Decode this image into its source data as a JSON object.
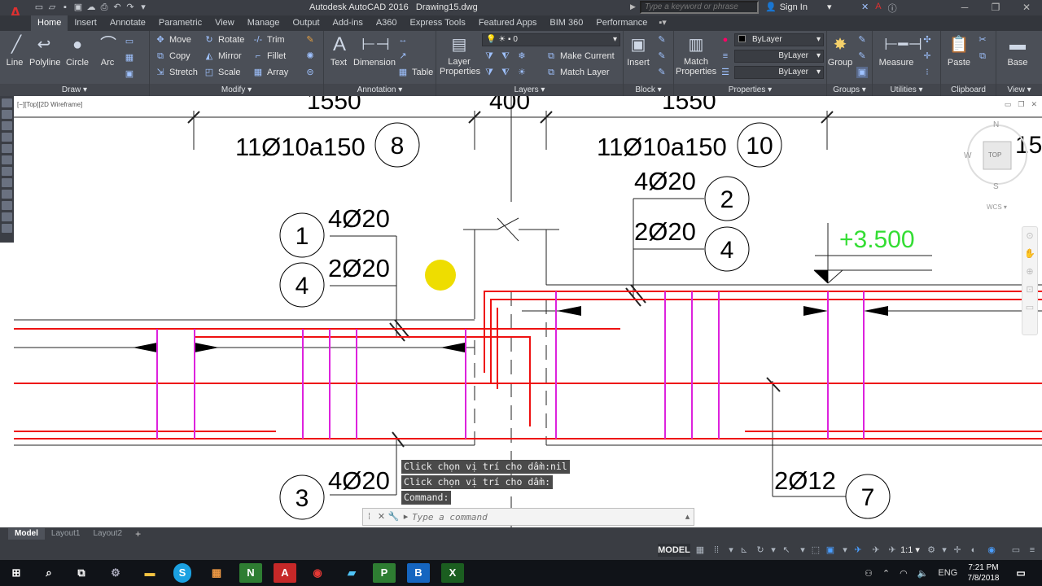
{
  "app": {
    "title": "Autodesk AutoCAD 2016",
    "drawing": "Drawing15.dwg",
    "logo": "A"
  },
  "search": {
    "placeholder": "Type a keyword or phrase"
  },
  "account": {
    "signin": "Sign In"
  },
  "ribbon_tabs": [
    "Home",
    "Insert",
    "Annotate",
    "Parametric",
    "View",
    "Manage",
    "Output",
    "Add-ins",
    "A360",
    "Express Tools",
    "Featured Apps",
    "BIM 360",
    "Performance"
  ],
  "draw": {
    "title": "Draw",
    "line": "Line",
    "polyline": "Polyline",
    "circle": "Circle",
    "arc": "Arc"
  },
  "modify": {
    "title": "Modify",
    "move": "Move",
    "rotate": "Rotate",
    "trim": "Trim",
    "copy": "Copy",
    "mirror": "Mirror",
    "fillet": "Fillet",
    "stretch": "Stretch",
    "scale": "Scale",
    "array": "Array"
  },
  "annotation": {
    "title": "Annotation",
    "text": "Text",
    "dimension": "Dimension",
    "table": "Table"
  },
  "layers": {
    "title": "Layers",
    "properties": "Layer\nProperties",
    "current": "0",
    "make_current": "Make Current",
    "match_layer": "Match Layer"
  },
  "block": {
    "title": "Block",
    "insert": "Insert"
  },
  "properties": {
    "title": "Properties",
    "match": "Match\nProperties",
    "color": "ByLayer",
    "linetype": "ByLayer",
    "lineweight": "ByLayer"
  },
  "groups": {
    "title": "Groups",
    "group": "Group"
  },
  "utilities": {
    "title": "Utilities",
    "measure": "Measure"
  },
  "clipboard": {
    "title": "Clipboard",
    "paste": "Paste"
  },
  "view": {
    "title": "View",
    "base": "Base"
  },
  "viewport": {
    "label": "[−][Top][2D Wireframe]"
  },
  "viewcube": {
    "n": "N",
    "s": "S",
    "w": "W",
    "top": "TOP",
    "wcs": "WCS"
  },
  "drawing": {
    "dims": [
      "1550",
      "400",
      "1550",
      "15"
    ],
    "rebar_labels": [
      "11Ø10a150",
      "11Ø10a150",
      "4Ø20",
      "2Ø20",
      "4Ø20",
      "2Ø20",
      "4Ø20",
      "2Ø12"
    ],
    "bubbles": [
      "8",
      "10",
      "2",
      "4",
      "1",
      "4",
      "3",
      "7"
    ],
    "elevation": "+3.500"
  },
  "command": {
    "history": [
      "Click chọn vị trí cho dầm:nil",
      "Click chọn vị trí cho dầm:",
      "Command:"
    ],
    "placeholder": "Type a command"
  },
  "layout_tabs": [
    "Model",
    "Layout1",
    "Layout2"
  ],
  "status": {
    "model": "MODEL",
    "scale": "1:1"
  },
  "taskbar": {
    "lang": "ENG",
    "time": "7:21 PM",
    "date": "7/8/2018"
  },
  "colors": {
    "rebar": "#ee1111",
    "stirrup": "#dd22dd",
    "elevation": "#33dd33",
    "marker": "#eedd00"
  }
}
